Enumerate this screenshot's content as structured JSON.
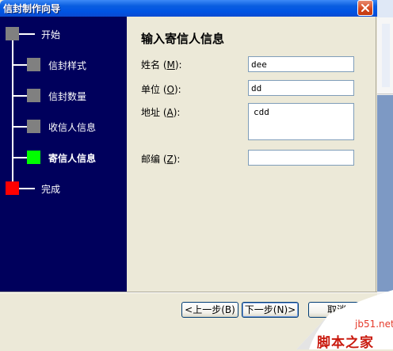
{
  "window": {
    "title": "信封制作向导",
    "close_icon": "close-icon"
  },
  "nav": {
    "steps": [
      {
        "label": "开始",
        "color": "#808080"
      },
      {
        "label": "信封样式",
        "color": "#808080"
      },
      {
        "label": "信封数量",
        "color": "#808080"
      },
      {
        "label": "收信人信息",
        "color": "#808080"
      },
      {
        "label": "寄信人信息",
        "color": "#00ff00",
        "current": true
      },
      {
        "label": "完成",
        "color": "#ff0000"
      }
    ]
  },
  "content": {
    "title": "输入寄信人信息",
    "fields": {
      "name": {
        "label": "姓名",
        "accel": "M",
        "value": "dee"
      },
      "company": {
        "label": "单位",
        "accel": "O",
        "value": "dd"
      },
      "address": {
        "label": "地址",
        "accel": "A",
        "value": "cdd"
      },
      "postcode": {
        "label": "邮编",
        "accel": "Z",
        "value": ""
      }
    }
  },
  "buttons": {
    "back": "<上一步(B)",
    "next": "下一步(N)>",
    "cancel": "取消"
  },
  "watermark": {
    "site": "jb51.net",
    "brand": "脚本之家"
  },
  "colors": {
    "nav_bg": "#00005c",
    "titlebar": "#0054e3",
    "dialog_bg": "#ece9d8",
    "watermark": "#c91a0e"
  }
}
